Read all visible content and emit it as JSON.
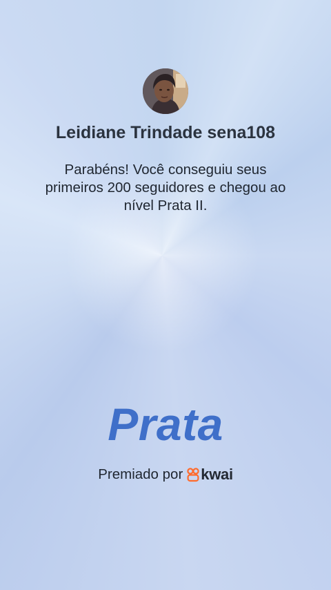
{
  "user": {
    "avatar_icon": "user-avatar-photo",
    "name": "Leidiane Trindade sena108"
  },
  "message": "Parabéns! Você conseguiu seus primeiros 200 seguidores e chegou ao nível Prata II.",
  "level": {
    "name": "Prata",
    "color": "#3f6fc9"
  },
  "award": {
    "label": "Premiado por",
    "brand": "kwai",
    "brand_color": "#ff6b2c",
    "brand_icon": "kwai-logo-icon"
  }
}
